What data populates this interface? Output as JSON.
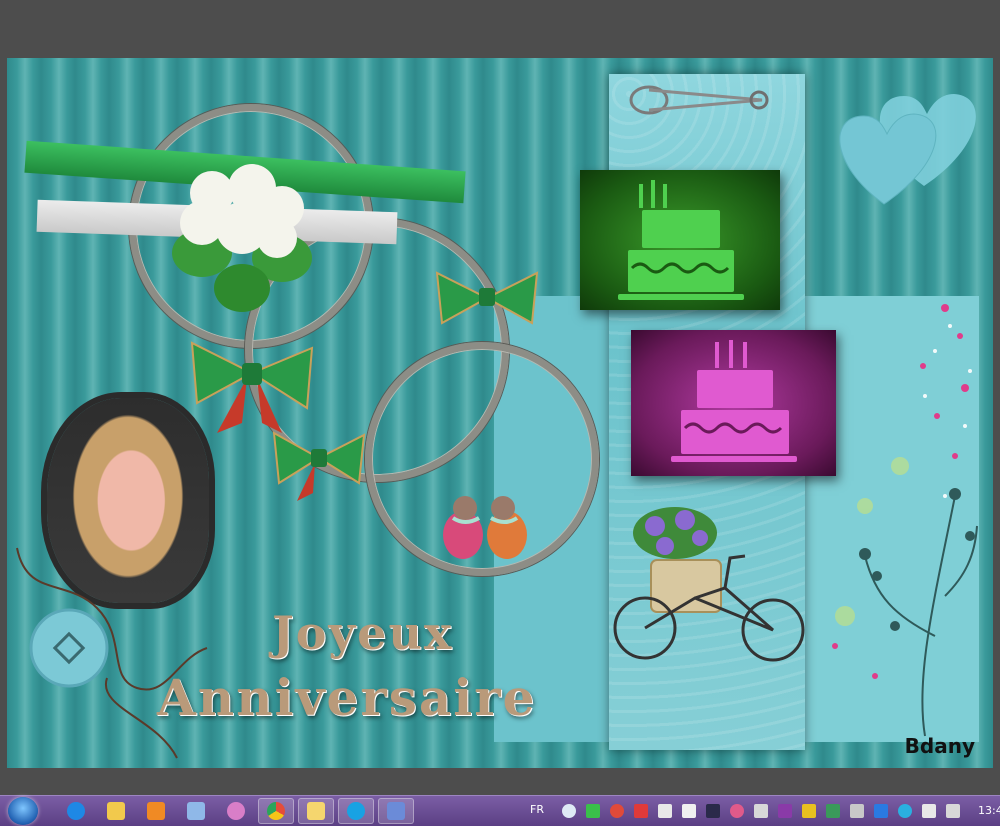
{
  "card": {
    "title_line1": "Joyeux",
    "title_line2": "Anniversaire",
    "signature": "Bdany"
  },
  "taskbar": {
    "apps": [
      {
        "name": "internet-explorer",
        "color": "#1e88e5"
      },
      {
        "name": "file-explorer",
        "color": "#f2c94c"
      },
      {
        "name": "media-player",
        "color": "#f08a24"
      },
      {
        "name": "notepad",
        "color": "#8fb8e8"
      },
      {
        "name": "paint",
        "color": "#d97ec8"
      },
      {
        "name": "chrome",
        "color": "#e44d3a"
      },
      {
        "name": "folder",
        "color": "#f5d66e"
      },
      {
        "name": "skype",
        "color": "#18a2e3"
      },
      {
        "name": "app-s",
        "color": "#6b8bd8"
      }
    ],
    "language": "FR",
    "clock": "13:4"
  }
}
